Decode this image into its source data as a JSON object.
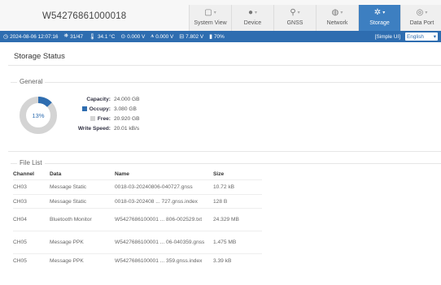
{
  "header": {
    "device_id": "W54276861000018",
    "tabs": [
      {
        "label": "System View",
        "icon": "monitor-icon",
        "glyph": "▢",
        "active": false
      },
      {
        "label": "Device",
        "icon": "device-icon",
        "glyph": "●",
        "active": false
      },
      {
        "label": "GNSS",
        "icon": "location-pin-icon",
        "glyph": "⚲",
        "active": false
      },
      {
        "label": "Network",
        "icon": "globe-icon",
        "glyph": "◍",
        "active": false
      },
      {
        "label": "Storage",
        "icon": "storage-icon",
        "glyph": "✲",
        "active": true
      },
      {
        "label": "Data Port",
        "icon": "data-port-icon",
        "glyph": "◎",
        "active": false
      }
    ]
  },
  "statusbar": {
    "datetime": "2024-08-06 12:07:16",
    "satellites": "31/47",
    "temperature": "34.1 °C",
    "voltage1": "0.000 V",
    "current": "0.000 V",
    "voltage2": "7.802 V",
    "battery": "70%",
    "simple_ui": "[Simple UI]",
    "language": "English"
  },
  "page": {
    "title": "Storage Status"
  },
  "general": {
    "legend": "General",
    "used_percent": 13,
    "used_label": "13%",
    "capacity_label": "Capacity:",
    "capacity": "24.000 GB",
    "occupy_label": "Occupy:",
    "occupy": "3.080 GB",
    "free_label": "Free:",
    "free": "20.920 GB",
    "write_speed_label": "Write Speed:",
    "write_speed": "20.01 kB/s",
    "colors": {
      "used": "#2e6db0",
      "free": "#d4d4d4"
    }
  },
  "file_list": {
    "legend": "File List",
    "columns": [
      "Channel",
      "Data",
      "Name",
      "Size"
    ],
    "rows": [
      {
        "channel": "CH03",
        "data": "Message Static",
        "name": "0018-03-20240806-040727.gnss",
        "size": "10.72 kB"
      },
      {
        "channel": "CH03",
        "data": "Message Static",
        "name": "0018-03-202408 ... 727.gnss.index",
        "size": "128 B"
      },
      {
        "channel": "CH04",
        "data": "Bluetooth Monitor",
        "name": "W5427686100001 ... 806-002529.txt",
        "size": "24.329 MB"
      },
      {
        "channel": "CH05",
        "data": "Message PPK",
        "name": "W5427686100001 ... 06-040359.gnss",
        "size": "1.475 MB"
      },
      {
        "channel": "CH05",
        "data": "Message PPK",
        "name": "W5427686100001 ... 359.gnss.index",
        "size": "3.39 kB"
      }
    ]
  }
}
